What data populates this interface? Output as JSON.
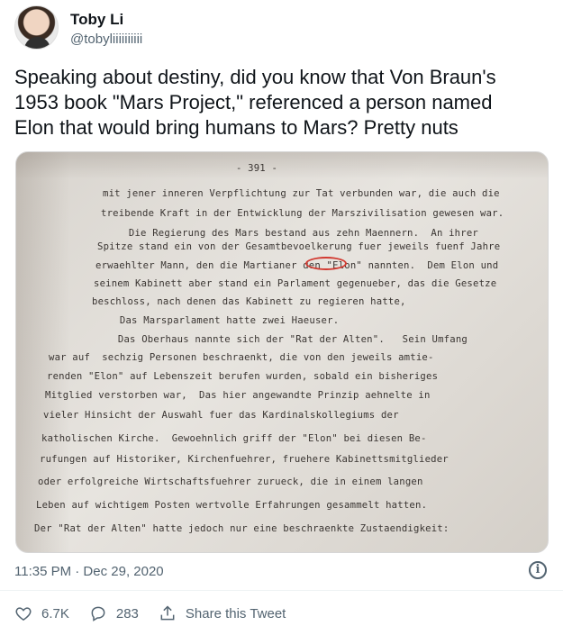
{
  "user": {
    "name": "Toby Li",
    "handle": "@tobyliiiiiiiiii"
  },
  "tweet": {
    "text": "Speaking about destiny, did you know that Von Braun's\n1953 book \"Mars Project,\" referenced a person named\nElon that would bring humans to Mars? Pretty nuts",
    "timestamp": "11:35 PM · Dec 29, 2020"
  },
  "image": {
    "page_number": "- 391 -",
    "lines": [
      "mit jener inneren Verpflichtung zur Tat verbunden war, die auch die",
      "treibende Kraft in der Entwicklung der Marszivilisation gewesen war.",
      "     Die Regierung des Mars bestand aus zehn Maennern.  An ihrer",
      "Spitze stand ein von der Gesamtbevoelkerung fuer jeweils fuenf Jahre",
      "erwaehlter Mann, den die Martianer den \"Elon\" nannten.  Dem Elon und",
      "seinem Kabinett aber stand ein Parlament gegenueber, das die Gesetze",
      "beschloss, nach denen das Kabinett zu regieren hatte,",
      "     Das Marsparlament hatte zwei Haeuser.",
      "     Das Oberhaus nannte sich der \"Rat der Alten\".   Sein Umfang",
      "war auf  sechzig Personen beschraenkt, die von den jeweils amtie-",
      "renden \"Elon\" auf Lebenszeit berufen wurden, sobald ein bisheriges",
      "Mitglied verstorben war,  Das hier angewandte Prinzip aehnelte in",
      "vieler Hinsicht der Auswahl fuer das Kardinalskollegiums der",
      "katholischen Kirche.  Gewoehnlich griff der \"Elon\" bei diesen Be-",
      "rufungen auf Historiker, Kirchenfuehrer, fruehere Kabinettsmitglieder",
      "oder erfolgreiche Wirtschaftsfuehrer zurueck, die in einem langen",
      "Leben auf wichtigem Posten wertvolle Erfahrungen gesammelt hatten.",
      "Der \"Rat der Alten\" hatte jedoch nur eine beschraenkte Zustaendigkeit:"
    ]
  },
  "actions": {
    "likes": "6.7K",
    "replies": "283",
    "share_label": "Share this Tweet"
  },
  "icons": {
    "like": "heart-icon",
    "reply": "reply-icon",
    "share": "share-icon",
    "info": "info-icon"
  },
  "colors": {
    "text": "#0f1419",
    "secondary": "#536471",
    "highlight_circle": "#d23b32"
  }
}
